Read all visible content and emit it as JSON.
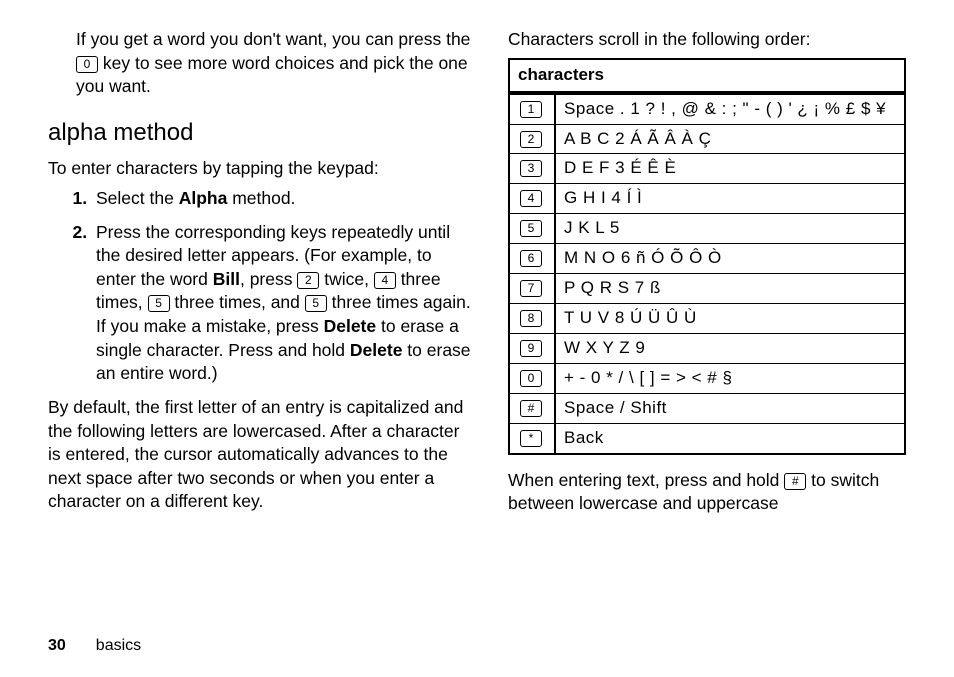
{
  "left": {
    "intro_p1_a": "If you get a word you don't want, you can press the ",
    "intro_p1_key": "0",
    "intro_p1_b": " key to see more word choices and pick the one you want.",
    "heading": "alpha method",
    "lead": "To enter characters by tapping the keypad:",
    "step1_a": "Select the ",
    "step1_bold": "Alpha",
    "step1_b": " method.",
    "step2_a": "Press the corresponding keys repeatedly until the desired letter appears. (For example, to enter the word ",
    "step2_bill": "Bill",
    "step2_b": ", press ",
    "k2": "2",
    "step2_c": " twice, ",
    "k4": "4",
    "step2_d": " three times, ",
    "k5a": "5",
    "step2_e": " three times, and ",
    "k5b": "5",
    "step2_f": " three times again. If you make a mistake, press ",
    "del1": "Delete",
    "step2_g": " to erase a single character. Press and hold ",
    "del2": "Delete",
    "step2_h": " to erase an entire word.)",
    "para2": "By default, the first letter of an entry is capitalized and the following letters are lowercased. After a character is entered, the cursor automatically advances to the next space after two seconds or when you enter a character on a different key."
  },
  "right": {
    "intro": "Characters scroll in the following order:",
    "header": "characters",
    "rows": [
      {
        "key": "1",
        "val": "Space . 1 ? ! , @ & : ; \" - ( ) ' ¿ ¡ % £ $ ¥"
      },
      {
        "key": "2",
        "val": "A B C 2 Á Ã Â À Ç"
      },
      {
        "key": "3",
        "val": "D E F 3 É Ê È"
      },
      {
        "key": "4",
        "val": "G H I 4 Í Ì"
      },
      {
        "key": "5",
        "val": "J K L 5"
      },
      {
        "key": "6",
        "val": "M N O 6 ñ Ó Õ Ô Ò"
      },
      {
        "key": "7",
        "val": "P Q R S 7 ß"
      },
      {
        "key": "8",
        "val": "T U V 8 Ú Ü Û Ù"
      },
      {
        "key": "9",
        "val": "W X Y Z 9"
      },
      {
        "key": "0",
        "val": "+ - 0 * / \\ [ ] = > < # §"
      },
      {
        "key": "#",
        "val": "Space / Shift"
      },
      {
        "key": "*",
        "val": "Back"
      }
    ],
    "tail_a": "When entering text, press and hold ",
    "tail_key": "#",
    "tail_b": " to switch between lowercase and uppercase"
  },
  "footer": {
    "page": "30",
    "section": "basics"
  }
}
